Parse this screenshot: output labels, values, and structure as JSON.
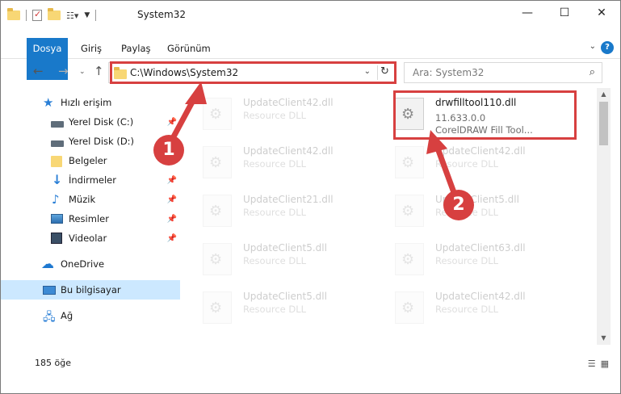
{
  "window": {
    "title": "System32",
    "controls": {
      "minimize": "—",
      "maximize": "☐",
      "close": "✕"
    }
  },
  "ribbon": {
    "tabs": [
      "Dosya",
      "Giriş",
      "Paylaş",
      "Görünüm"
    ],
    "help": "?"
  },
  "address": {
    "path": "C:\\Windows\\System32",
    "search_placeholder": "Ara: System32"
  },
  "sidebar": {
    "items": [
      {
        "label": "Hızlı erişim",
        "icon": "quick-access-icon"
      },
      {
        "label": "Yerel Disk (C:)",
        "icon": "drive-icon",
        "pinned": true
      },
      {
        "label": "Yerel Disk (D:)",
        "icon": "drive-icon"
      },
      {
        "label": "Belgeler",
        "icon": "documents-icon"
      },
      {
        "label": "İndirmeler",
        "icon": "downloads-icon",
        "pinned": true
      },
      {
        "label": "Müzik",
        "icon": "music-icon",
        "pinned": true
      },
      {
        "label": "Resimler",
        "icon": "pictures-icon",
        "pinned": true
      },
      {
        "label": "Videolar",
        "icon": "videos-icon",
        "pinned": true
      },
      {
        "label": "OneDrive",
        "icon": "onedrive-icon"
      },
      {
        "label": "Bu bilgisayar",
        "icon": "this-pc-icon",
        "selected": true
      },
      {
        "label": "Ağ",
        "icon": "network-icon"
      }
    ]
  },
  "files": [
    {
      "name": "UpdateClient42.dll",
      "version": "",
      "desc": "Resource DLL",
      "faded": true
    },
    {
      "name": "drwfilltool110.dll",
      "version": "11.633.0.0",
      "desc": "CorelDRAW Fill Tool...",
      "faded": false
    },
    {
      "name": "UpdateClient42.dll",
      "version": "",
      "desc": "Resource DLL",
      "faded": true
    },
    {
      "name": "UpdateClient42.dll",
      "version": "",
      "desc": "Resource DLL",
      "faded": true
    },
    {
      "name": "UpdateClient21.dll",
      "version": "",
      "desc": "Resource DLL",
      "faded": true
    },
    {
      "name": "UpdateClient5.dll",
      "version": "",
      "desc": "Resource DLL",
      "faded": true
    },
    {
      "name": "UpdateClient5.dll",
      "version": "",
      "desc": "Resource DLL",
      "faded": true
    },
    {
      "name": "UpdateClient63.dll",
      "version": "",
      "desc": "Resource DLL",
      "faded": true
    },
    {
      "name": "UpdateClient5.dll",
      "version": "",
      "desc": "Resource DLL",
      "faded": true
    },
    {
      "name": "UpdateClient42.dll",
      "version": "",
      "desc": "Resource DLL",
      "faded": true
    }
  ],
  "status": {
    "count": "185 öğe"
  },
  "annotations": {
    "badge1": "1",
    "badge2": "2",
    "color": "#d74040"
  }
}
